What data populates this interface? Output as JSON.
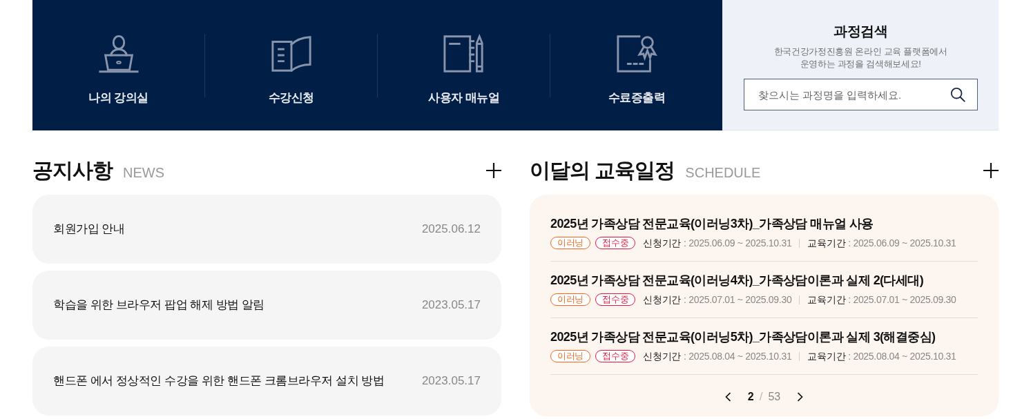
{
  "quick_links": [
    {
      "label": "나의 강의실",
      "kind": "classroom"
    },
    {
      "label": "수강신청",
      "kind": "book"
    },
    {
      "label": "사용자 매뉴얼",
      "kind": "notebook"
    },
    {
      "label": "수료증출력",
      "kind": "certificate"
    }
  ],
  "course_search": {
    "title": "과정검색",
    "description_lines": [
      "한국건강가정진흥원 온라인 교육 플랫폼에서",
      "운영하는 과정을 검색해보세요!"
    ],
    "search": {
      "placeholder": "찾으시는 과정명을 입력하세요."
    }
  },
  "news": {
    "title": "공지사항",
    "subtitle": "NEWS",
    "items": [
      {
        "title": "회원가입 안내",
        "date": "2025.06.12"
      },
      {
        "title": "학습을 위한 브라우저 팝업 해제 방법 알림",
        "date": "2023.05.17"
      },
      {
        "title": "핸드폰 에서 정상적인 수강을 위한 핸드폰 크롬브라우저 설치 방법",
        "date": "2023.05.17"
      }
    ]
  },
  "schedule": {
    "title": "이달의 교육일정",
    "subtitle": "SCHEDULE",
    "items": [
      {
        "title": "2025년 가족상담 전문교육(이러닝3차)_가족상담 매뉴얼 사용",
        "tags": [
          {
            "label": "이러닝",
            "color": "#f26a21"
          },
          {
            "label": "접수중",
            "color": "#e5173f"
          }
        ],
        "apply_label": "신청기간",
        "apply_period": ": 2025.06.09 ~ 2025.10.31",
        "edu_label": "교육기간",
        "edu_period": ": 2025.06.09 ~ 2025.10.31"
      },
      {
        "title": "2025년 가족상담 전문교육(이러닝4차)_가족상담이론과 실제 2(다세대)",
        "tags": [
          {
            "label": "이러닝",
            "color": "#f26a21"
          },
          {
            "label": "접수중",
            "color": "#e5173f"
          }
        ],
        "apply_label": "신청기간",
        "apply_period": ": 2025.07.01 ~ 2025.09.30",
        "edu_label": "교육기간",
        "edu_period": ": 2025.07.01 ~ 2025.09.30"
      },
      {
        "title": "2025년 가족상담 전문교육(이러닝5차)_가족상담이론과 실제 3(해결중심)",
        "tags": [
          {
            "label": "이러닝",
            "color": "#f26a21"
          },
          {
            "label": "접수중",
            "color": "#e5173f"
          }
        ],
        "apply_label": "신청기간",
        "apply_period": ": 2025.08.04 ~ 2025.10.31",
        "edu_label": "교육기간",
        "edu_period": ": 2025.08.04 ~ 2025.10.31"
      }
    ],
    "pagination": {
      "current": "2",
      "separator": "/",
      "total": "53"
    }
  }
}
